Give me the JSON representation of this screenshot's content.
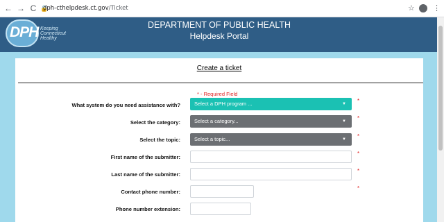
{
  "browser": {
    "back_icon": "←",
    "forward_icon": "→",
    "reload_icon": "C",
    "url_host": "dph-cthelpdesk.ct.gov",
    "url_path": "/Ticket",
    "star_icon": "☆",
    "menu_icon": "⋮"
  },
  "header": {
    "logo_text": "DPH",
    "logo_tag_line1": "Keeping",
    "logo_tag_line2": "Connecticut",
    "logo_tag_line3": "Healthy",
    "title": "DEPARTMENT OF PUBLIC HEALTH",
    "subtitle": "Helpdesk Portal"
  },
  "form": {
    "title": "Create a ticket",
    "required_note": "* - Required Field",
    "required_mark": "*",
    "caret": "▼",
    "fields": [
      {
        "label": "What system do you need assistance with?",
        "value": "Select a DPH program ..."
      },
      {
        "label": "Select the category:",
        "value": "Select a category..."
      },
      {
        "label": "Select the topic:",
        "value": "Select a topic..."
      },
      {
        "label": "First name of the submitter:",
        "value": ""
      },
      {
        "label": "Last name of the submitter:",
        "value": ""
      },
      {
        "label": "Contact phone number:",
        "value": ""
      },
      {
        "label": "Phone number extension:",
        "value": ""
      }
    ]
  },
  "colors": {
    "header_bg": "#2f5d86",
    "page_bg": "#9fd9ec",
    "select_teal": "#1bc1b3",
    "select_gray": "#6c6f73",
    "required_red": "#e02020"
  }
}
